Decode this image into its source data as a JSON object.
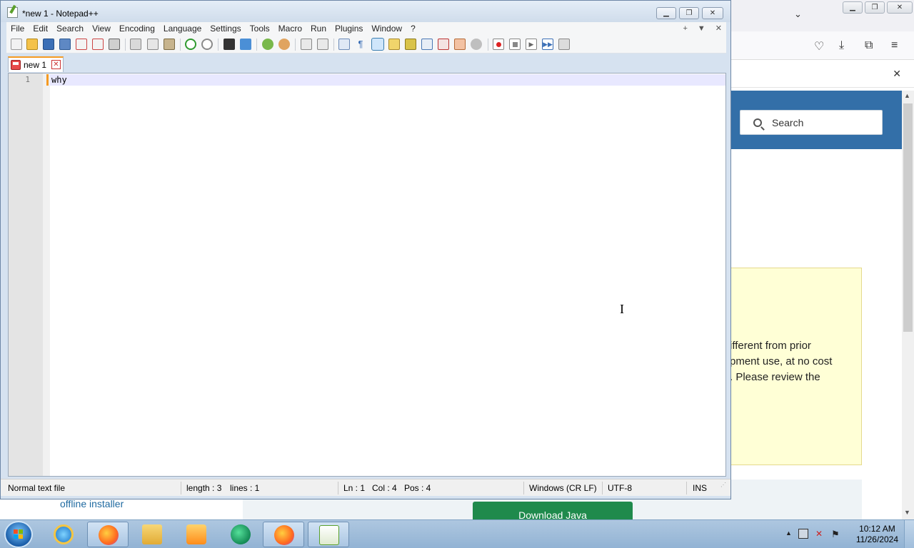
{
  "browser": {
    "search_placeholder": "Search",
    "notice_lines": [
      "ifferent from prior",
      "pment use, at no cost",
      ". Please review the"
    ],
    "offline_link": "offline installer",
    "download_button": "Download Java"
  },
  "notepad": {
    "title": "*new 1 - Notepad++",
    "menu": [
      "File",
      "Edit",
      "Search",
      "View",
      "Encoding",
      "Language",
      "Settings",
      "Tools",
      "Macro",
      "Run",
      "Plugins",
      "Window",
      "?"
    ],
    "menu_right": [
      "+",
      "▼",
      "✕"
    ],
    "tab": {
      "label": "new 1"
    },
    "editor": {
      "line_number": "1",
      "line_text": "why"
    },
    "status": {
      "file_type": "Normal text file",
      "length": "length : 3",
      "lines": "lines : 1",
      "ln": "Ln : 1",
      "col": "Col : 4",
      "pos": "Pos : 4",
      "eol": "Windows (CR LF)",
      "encoding": "UTF-8",
      "mode": "INS"
    }
  },
  "taskbar": {
    "apps": [
      "internet-explorer",
      "firefox",
      "file-explorer",
      "media-player",
      "app-green",
      "firefox",
      "notepad-plus-plus"
    ],
    "clock_time": "10:12 AM",
    "clock_date": "11/26/2024"
  },
  "colors": {
    "accent_orange": "#f59a23",
    "browser_header": "#336fa8",
    "notice_bg": "#ffffd6",
    "java_green": "#1f8a4c"
  }
}
